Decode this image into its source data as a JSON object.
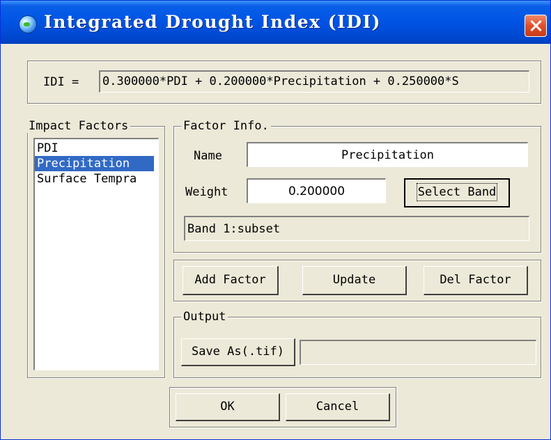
{
  "window": {
    "title": "Integrated Drought Index (IDI)",
    "icon": "globe-icon",
    "close_icon": "close-icon"
  },
  "formula": {
    "label": "IDI =",
    "value": "0.300000*PDI + 0.200000*Precipitation + 0.250000*S"
  },
  "impact_factors": {
    "legend": "Impact Factors",
    "items": [
      {
        "label": "PDI",
        "selected": false
      },
      {
        "label": "Precipitation",
        "selected": true
      },
      {
        "label": "Surface Tempra",
        "selected": false
      }
    ]
  },
  "factor_info": {
    "legend": "Factor Info.",
    "name_label": "Name",
    "name_value": "Precipitation",
    "weight_label": "Weight",
    "weight_value": "0.200000",
    "select_band_label": "Select Band",
    "band_value": "Band 1:subset"
  },
  "factor_actions": {
    "add_label": "Add Factor",
    "update_label": "Update",
    "delete_label": "Del Factor"
  },
  "output": {
    "legend": "Output",
    "save_label": "Save As(.tif)",
    "path_value": ""
  },
  "footer": {
    "ok_label": "OK",
    "cancel_label": "Cancel"
  },
  "colors": {
    "titlebar": "#0055e5",
    "face": "#ece9d8",
    "selection": "#316ac5",
    "close": "#e0502a"
  }
}
